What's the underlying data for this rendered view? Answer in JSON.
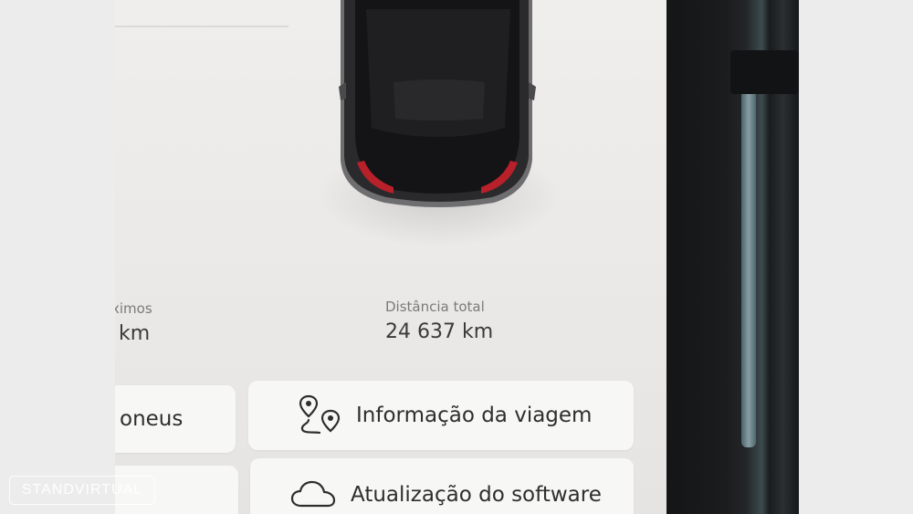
{
  "stats": {
    "partial_label": "ximos",
    "partial_value": "km",
    "total_label": "Distância total",
    "total_value": "24 637 km"
  },
  "buttons": {
    "partial_label": "oneus",
    "trip_info": "Informação da viagem",
    "software_update": "Atualização do software"
  },
  "icons": {
    "trip": "route-pins-icon",
    "software": "cloud-icon"
  },
  "watermark": "STANDVIRTUAL",
  "colors": {
    "screen_bg": "#ece9e7",
    "button_bg": "#f7f7f6",
    "text_primary": "#2e2e2e",
    "text_secondary": "#7a7a7a",
    "car_body": "#1d1d1f",
    "tail_light": "#b8202a"
  }
}
